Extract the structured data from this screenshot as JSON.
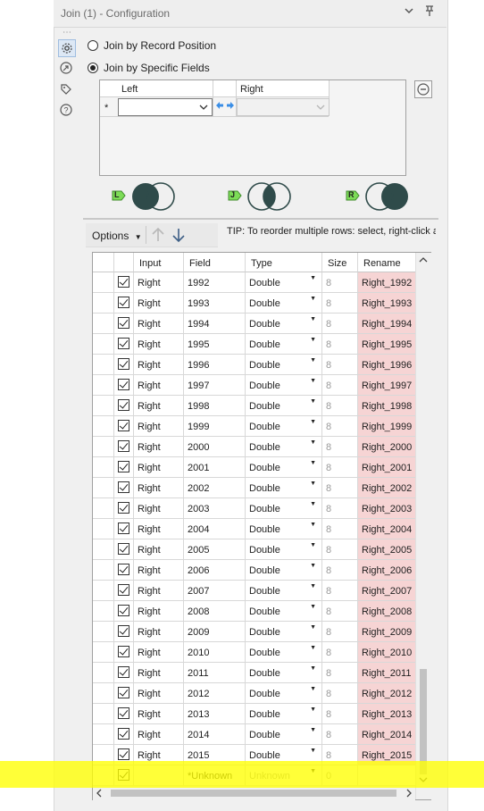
{
  "window": {
    "title": "Join (1) - Configuration"
  },
  "join_mode": {
    "by_position_label": "Join by Record Position",
    "by_fields_label": "Join by Specific Fields",
    "selected": "by_fields"
  },
  "join_fields": {
    "left_header": "Left",
    "right_header": "Right",
    "row_marker": "*",
    "left_value": "",
    "right_value": ""
  },
  "venn": {
    "left_label": "L",
    "join_label": "J",
    "right_label": "R"
  },
  "toolbar": {
    "options_label": "Options",
    "tip": "TIP: To reorder multiple rows: select, right-click and drag."
  },
  "table": {
    "columns": [
      "Input",
      "Field",
      "Type",
      "Size",
      "Rename"
    ],
    "rows": [
      {
        "input": "Right",
        "field": "1992",
        "type": "Double",
        "size": "8",
        "rename": "Right_1992"
      },
      {
        "input": "Right",
        "field": "1993",
        "type": "Double",
        "size": "8",
        "rename": "Right_1993"
      },
      {
        "input": "Right",
        "field": "1994",
        "type": "Double",
        "size": "8",
        "rename": "Right_1994"
      },
      {
        "input": "Right",
        "field": "1995",
        "type": "Double",
        "size": "8",
        "rename": "Right_1995"
      },
      {
        "input": "Right",
        "field": "1996",
        "type": "Double",
        "size": "8",
        "rename": "Right_1996"
      },
      {
        "input": "Right",
        "field": "1997",
        "type": "Double",
        "size": "8",
        "rename": "Right_1997"
      },
      {
        "input": "Right",
        "field": "1998",
        "type": "Double",
        "size": "8",
        "rename": "Right_1998"
      },
      {
        "input": "Right",
        "field": "1999",
        "type": "Double",
        "size": "8",
        "rename": "Right_1999"
      },
      {
        "input": "Right",
        "field": "2000",
        "type": "Double",
        "size": "8",
        "rename": "Right_2000"
      },
      {
        "input": "Right",
        "field": "2001",
        "type": "Double",
        "size": "8",
        "rename": "Right_2001"
      },
      {
        "input": "Right",
        "field": "2002",
        "type": "Double",
        "size": "8",
        "rename": "Right_2002"
      },
      {
        "input": "Right",
        "field": "2003",
        "type": "Double",
        "size": "8",
        "rename": "Right_2003"
      },
      {
        "input": "Right",
        "field": "2004",
        "type": "Double",
        "size": "8",
        "rename": "Right_2004"
      },
      {
        "input": "Right",
        "field": "2005",
        "type": "Double",
        "size": "8",
        "rename": "Right_2005"
      },
      {
        "input": "Right",
        "field": "2006",
        "type": "Double",
        "size": "8",
        "rename": "Right_2006"
      },
      {
        "input": "Right",
        "field": "2007",
        "type": "Double",
        "size": "8",
        "rename": "Right_2007"
      },
      {
        "input": "Right",
        "field": "2008",
        "type": "Double",
        "size": "8",
        "rename": "Right_2008"
      },
      {
        "input": "Right",
        "field": "2009",
        "type": "Double",
        "size": "8",
        "rename": "Right_2009"
      },
      {
        "input": "Right",
        "field": "2010",
        "type": "Double",
        "size": "8",
        "rename": "Right_2010"
      },
      {
        "input": "Right",
        "field": "2011",
        "type": "Double",
        "size": "8",
        "rename": "Right_2011"
      },
      {
        "input": "Right",
        "field": "2012",
        "type": "Double",
        "size": "8",
        "rename": "Right_2012"
      },
      {
        "input": "Right",
        "field": "2013",
        "type": "Double",
        "size": "8",
        "rename": "Right_2013"
      },
      {
        "input": "Right",
        "field": "2014",
        "type": "Double",
        "size": "8",
        "rename": "Right_2014"
      },
      {
        "input": "Right",
        "field": "2015",
        "type": "Double",
        "size": "8",
        "rename": "Right_2015"
      },
      {
        "input": "",
        "field": "*Unknown",
        "type": "Unknown",
        "size": "0",
        "rename": "",
        "unknown": true
      }
    ]
  },
  "colors": {
    "rename_bg": "#f6d4d4",
    "highlight": "#ffff00",
    "venn_dark": "#2f4b4a",
    "tag_green": "#7ddc57"
  }
}
